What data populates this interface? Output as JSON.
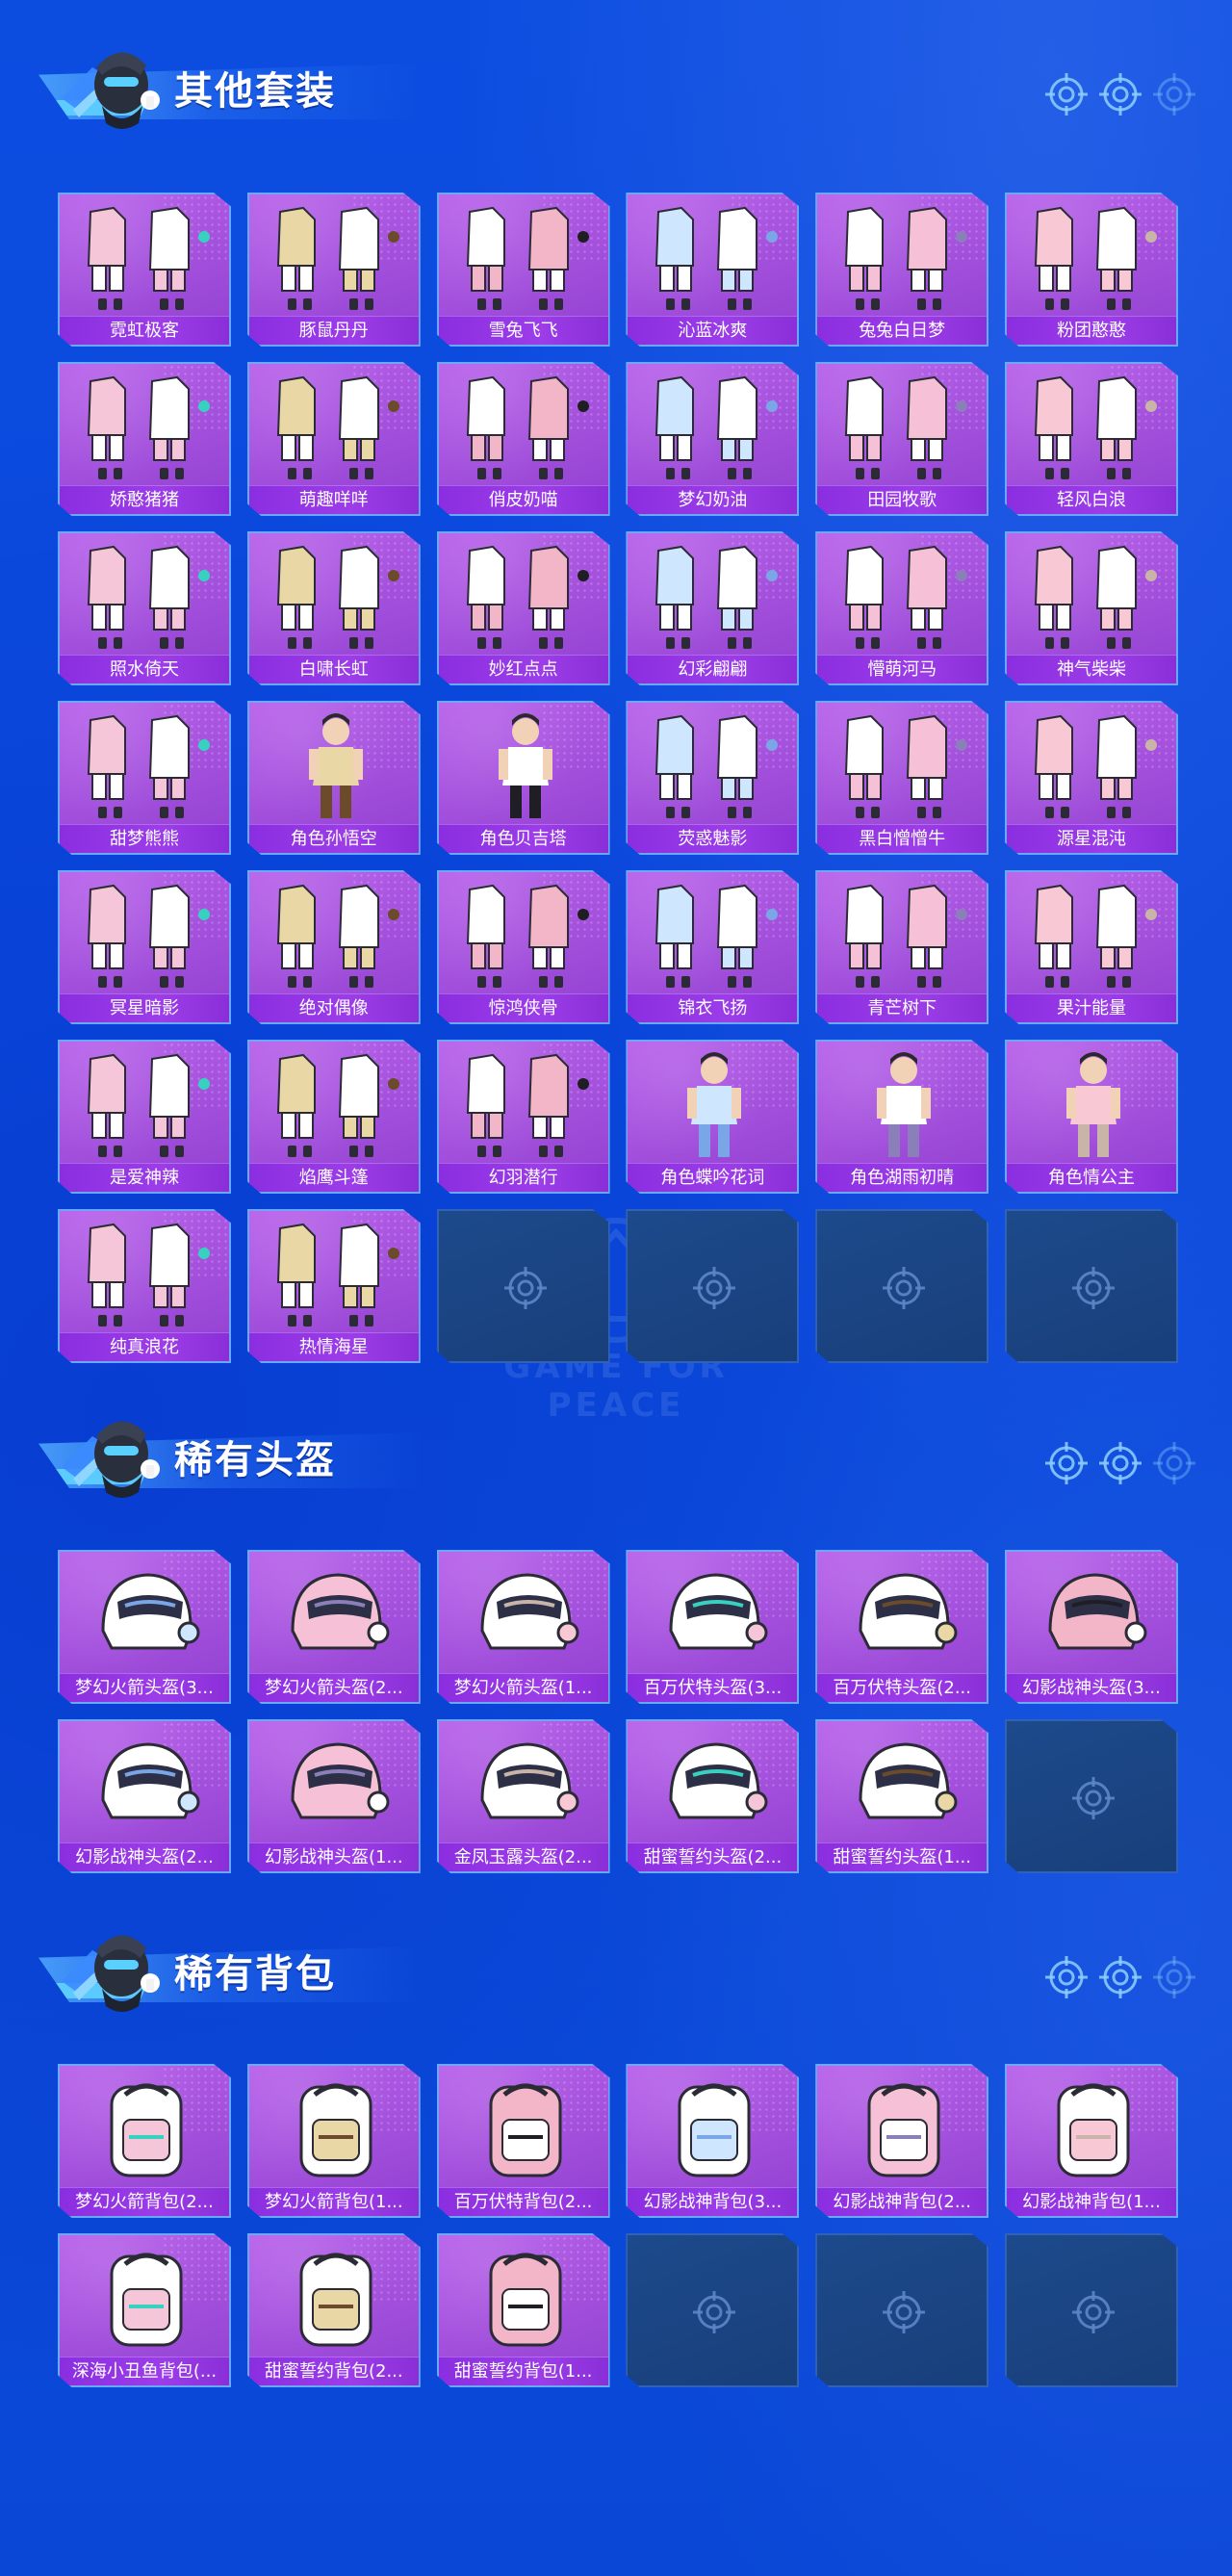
{
  "colors": {
    "background": "#0b4ada",
    "card_fill": "#a24fdc",
    "card_border": "#6aa7ff",
    "label_bar": "#8b2ee0",
    "empty_slot": "#1d4a8c"
  },
  "watermark": {
    "text": "GAME FOR PEACE"
  },
  "sections": [
    {
      "title": "其他套装",
      "icon": "soldier-mascot-icon",
      "deco_icons": [
        "crosshair-icon",
        "crosshair-icon",
        "crosshair-icon"
      ],
      "items": [
        {
          "label": "霓虹极客",
          "art": "outfit-icon"
        },
        {
          "label": "豚鼠丹丹",
          "art": "outfit-icon"
        },
        {
          "label": "雪兔飞飞",
          "art": "outfit-icon"
        },
        {
          "label": "沁蓝冰爽",
          "art": "outfit-icon"
        },
        {
          "label": "兔兔白日梦",
          "art": "outfit-icon"
        },
        {
          "label": "粉团憨憨",
          "art": "outfit-icon"
        },
        {
          "label": "娇憨猪猪",
          "art": "outfit-icon"
        },
        {
          "label": "萌趣咩咩",
          "art": "outfit-icon"
        },
        {
          "label": "俏皮奶喵",
          "art": "outfit-icon"
        },
        {
          "label": "梦幻奶油",
          "art": "outfit-icon"
        },
        {
          "label": "田园牧歌",
          "art": "outfit-icon"
        },
        {
          "label": "轻风白浪",
          "art": "outfit-icon"
        },
        {
          "label": "照水倚天",
          "art": "outfit-icon"
        },
        {
          "label": "白啸长虹",
          "art": "outfit-icon"
        },
        {
          "label": "妙红点点",
          "art": "outfit-icon"
        },
        {
          "label": "幻彩翩翩",
          "art": "outfit-icon"
        },
        {
          "label": "懵萌河马",
          "art": "outfit-icon"
        },
        {
          "label": "神气柴柴",
          "art": "outfit-icon"
        },
        {
          "label": "甜梦熊熊",
          "art": "outfit-icon"
        },
        {
          "label": "角色孙悟空",
          "art": "character-icon"
        },
        {
          "label": "角色贝吉塔",
          "art": "character-icon"
        },
        {
          "label": "荧惑魅影",
          "art": "outfit-icon"
        },
        {
          "label": "黑白憎憎牛",
          "art": "outfit-icon"
        },
        {
          "label": "源星混沌",
          "art": "outfit-icon"
        },
        {
          "label": "冥星暗影",
          "art": "outfit-icon"
        },
        {
          "label": "绝对偶像",
          "art": "outfit-icon"
        },
        {
          "label": "惊鸿侠骨",
          "art": "outfit-icon"
        },
        {
          "label": "锦衣飞扬",
          "art": "outfit-icon"
        },
        {
          "label": "青芒树下",
          "art": "outfit-icon"
        },
        {
          "label": "果汁能量",
          "art": "outfit-icon"
        },
        {
          "label": "是爱神辣",
          "art": "outfit-icon"
        },
        {
          "label": "焰鹰斗篷",
          "art": "outfit-icon"
        },
        {
          "label": "幻羽潜行",
          "art": "outfit-icon"
        },
        {
          "label": "角色蝶吟花词",
          "art": "character-icon"
        },
        {
          "label": "角色湖雨初晴",
          "art": "character-icon"
        },
        {
          "label": "角色情公主",
          "art": "character-icon"
        },
        {
          "label": "纯真浪花",
          "art": "outfit-icon"
        },
        {
          "label": "热情海星",
          "art": "outfit-icon"
        }
      ],
      "empty_slots": 4
    },
    {
      "title": "稀有头盔",
      "icon": "soldier-mascot-icon",
      "deco_icons": [
        "crosshair-icon",
        "crosshair-icon",
        "crosshair-icon"
      ],
      "items": [
        {
          "label": "梦幻火箭头盔(3...",
          "art": "helmet-icon"
        },
        {
          "label": "梦幻火箭头盔(2...",
          "art": "helmet-icon"
        },
        {
          "label": "梦幻火箭头盔(1...",
          "art": "helmet-icon"
        },
        {
          "label": "百万伏特头盔(3...",
          "art": "helmet-icon"
        },
        {
          "label": "百万伏特头盔(2...",
          "art": "helmet-icon"
        },
        {
          "label": "幻影战神头盔(3...",
          "art": "helmet-icon"
        },
        {
          "label": "幻影战神头盔(2...",
          "art": "helmet-icon"
        },
        {
          "label": "幻影战神头盔(1...",
          "art": "helmet-icon"
        },
        {
          "label": "金凤玉露头盔(2...",
          "art": "helmet-icon"
        },
        {
          "label": "甜蜜誓约头盔(2...",
          "art": "helmet-icon"
        },
        {
          "label": "甜蜜誓约头盔(1...",
          "art": "helmet-icon"
        }
      ],
      "empty_slots": 1
    },
    {
      "title": "稀有背包",
      "icon": "soldier-mascot-icon",
      "deco_icons": [
        "crosshair-icon",
        "crosshair-icon",
        "crosshair-icon"
      ],
      "items": [
        {
          "label": "梦幻火箭背包(2...",
          "art": "backpack-icon"
        },
        {
          "label": "梦幻火箭背包(1...",
          "art": "backpack-icon"
        },
        {
          "label": "百万伏特背包(2...",
          "art": "backpack-icon"
        },
        {
          "label": "幻影战神背包(3...",
          "art": "backpack-icon"
        },
        {
          "label": "幻影战神背包(2...",
          "art": "backpack-icon"
        },
        {
          "label": "幻影战神背包(1...",
          "art": "backpack-icon"
        },
        {
          "label": "深海小丑鱼背包(...",
          "art": "backpack-icon"
        },
        {
          "label": "甜蜜誓约背包(2...",
          "art": "backpack-icon"
        },
        {
          "label": "甜蜜誓约背包(1...",
          "art": "backpack-icon"
        }
      ],
      "empty_slots": 3
    }
  ]
}
